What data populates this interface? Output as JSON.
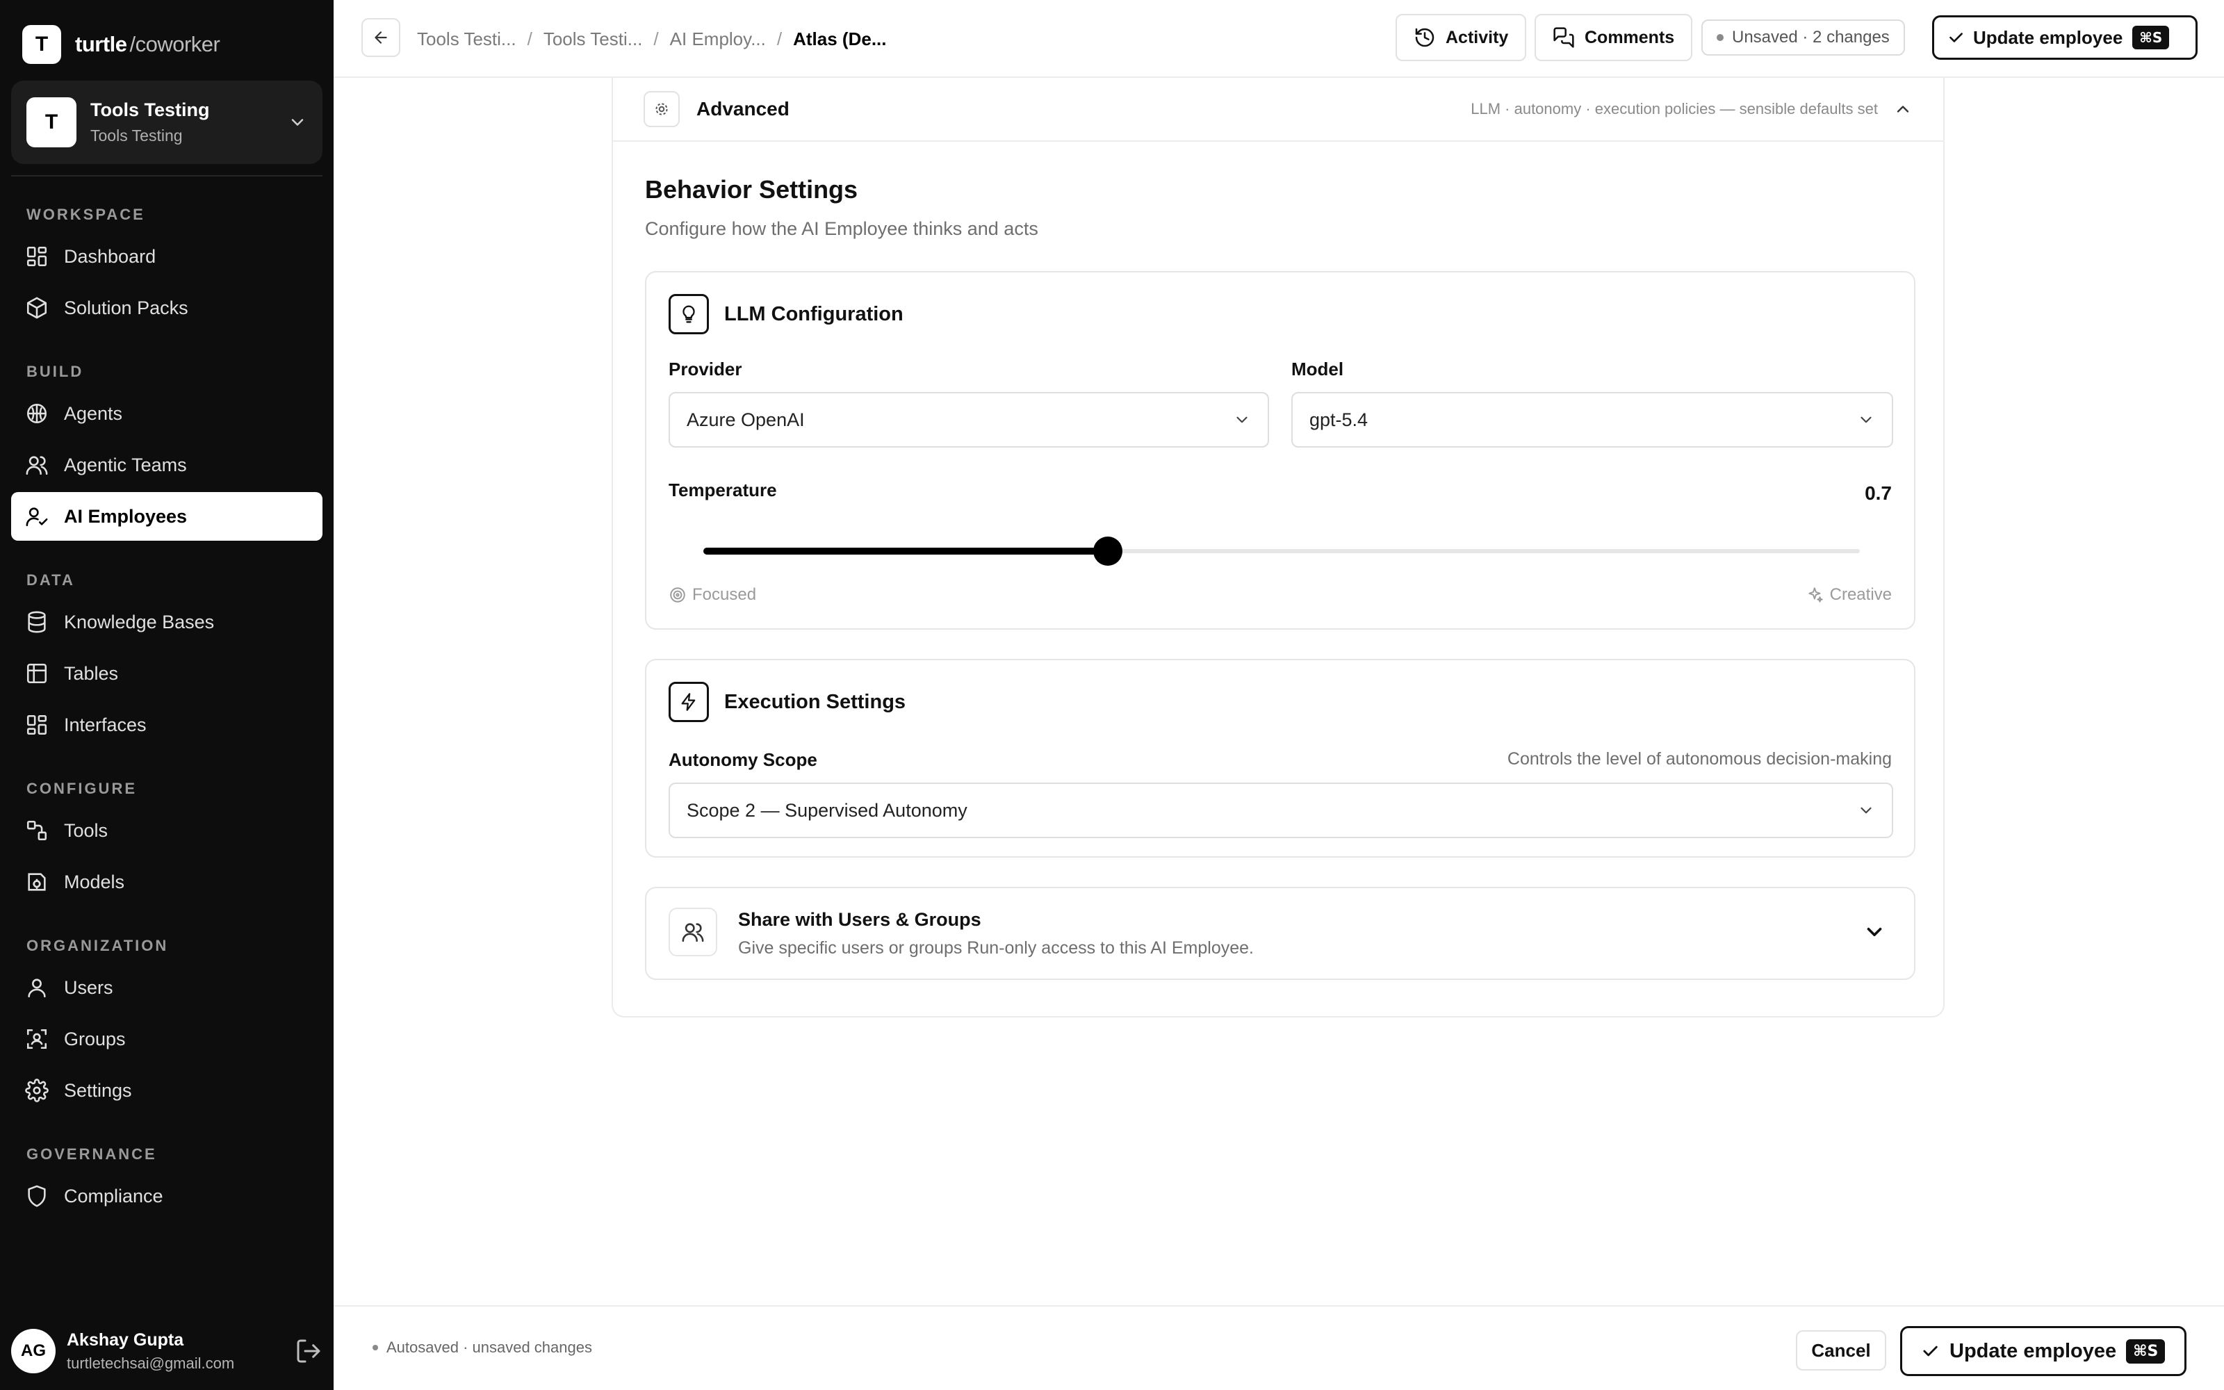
{
  "app": {
    "brand_main": "turtle",
    "brand_sub": "/coworker",
    "logo_letter": "T"
  },
  "workspace": {
    "avatar": "T",
    "name": "Tools Testing",
    "subtitle": "Tools Testing"
  },
  "sidebar": {
    "sections": [
      {
        "label": "WORKSPACE",
        "items": [
          {
            "label": "Dashboard",
            "icon": "dashboard-icon"
          },
          {
            "label": "Solution Packs",
            "icon": "package-icon"
          }
        ]
      },
      {
        "label": "BUILD",
        "items": [
          {
            "label": "Agents",
            "icon": "brain-icon"
          },
          {
            "label": "Agentic Teams",
            "icon": "users-icon"
          },
          {
            "label": "AI Employees",
            "icon": "user-check-icon",
            "active": true
          }
        ]
      },
      {
        "label": "DATA",
        "items": [
          {
            "label": "Knowledge Bases",
            "icon": "database-icon"
          },
          {
            "label": "Tables",
            "icon": "table-icon"
          },
          {
            "label": "Interfaces",
            "icon": "layout-icon"
          }
        ]
      },
      {
        "label": "CONFIGURE",
        "items": [
          {
            "label": "Tools",
            "icon": "tools-icon"
          },
          {
            "label": "Models",
            "icon": "model-icon"
          }
        ]
      },
      {
        "label": "ORGANIZATION",
        "items": [
          {
            "label": "Users",
            "icon": "user-icon"
          },
          {
            "label": "Groups",
            "icon": "group-icon"
          },
          {
            "label": "Settings",
            "icon": "gear-icon"
          }
        ]
      },
      {
        "label": "GOVERNANCE",
        "items": [
          {
            "label": "Compliance",
            "icon": "shield-icon"
          }
        ]
      }
    ]
  },
  "user": {
    "initials": "AG",
    "name": "Akshay Gupta",
    "email": "turtletechsai@gmail.com"
  },
  "topbar": {
    "breadcrumbs": [
      "Tools Testi...",
      "Tools Testi...",
      "AI Employ...",
      "Atlas (De..."
    ],
    "activity_label": "Activity",
    "comments_label": "Comments",
    "unsaved_label": "Unsaved · 2 changes",
    "update_label": "Update employee",
    "shortcut": "⌘S"
  },
  "advanced": {
    "title": "Advanced",
    "meta": "LLM · autonomy · execution policies — sensible defaults set"
  },
  "behavior": {
    "title": "Behavior Settings",
    "subtitle": "Configure how the AI Employee thinks and acts"
  },
  "llm": {
    "title": "LLM Configuration",
    "provider_label": "Provider",
    "provider_value": "Azure OpenAI",
    "model_label": "Model",
    "model_value": "gpt-5.4",
    "temperature_label": "Temperature",
    "temperature_value": "0.7",
    "temperature_fraction": 0.35,
    "hint_low": "Focused",
    "hint_high": "Creative"
  },
  "execution": {
    "title": "Execution Settings",
    "autonomy_label": "Autonomy Scope",
    "autonomy_desc": "Controls the level of autonomous decision-making",
    "autonomy_value": "Scope 2 — Supervised Autonomy"
  },
  "share": {
    "title": "Share with Users & Groups",
    "subtitle": "Give specific users or groups Run-only access to this AI Employee."
  },
  "footer": {
    "autosave": "Autosaved · unsaved changes",
    "cancel_label": "Cancel",
    "update_label": "Update employee",
    "shortcut": "⌘S"
  }
}
